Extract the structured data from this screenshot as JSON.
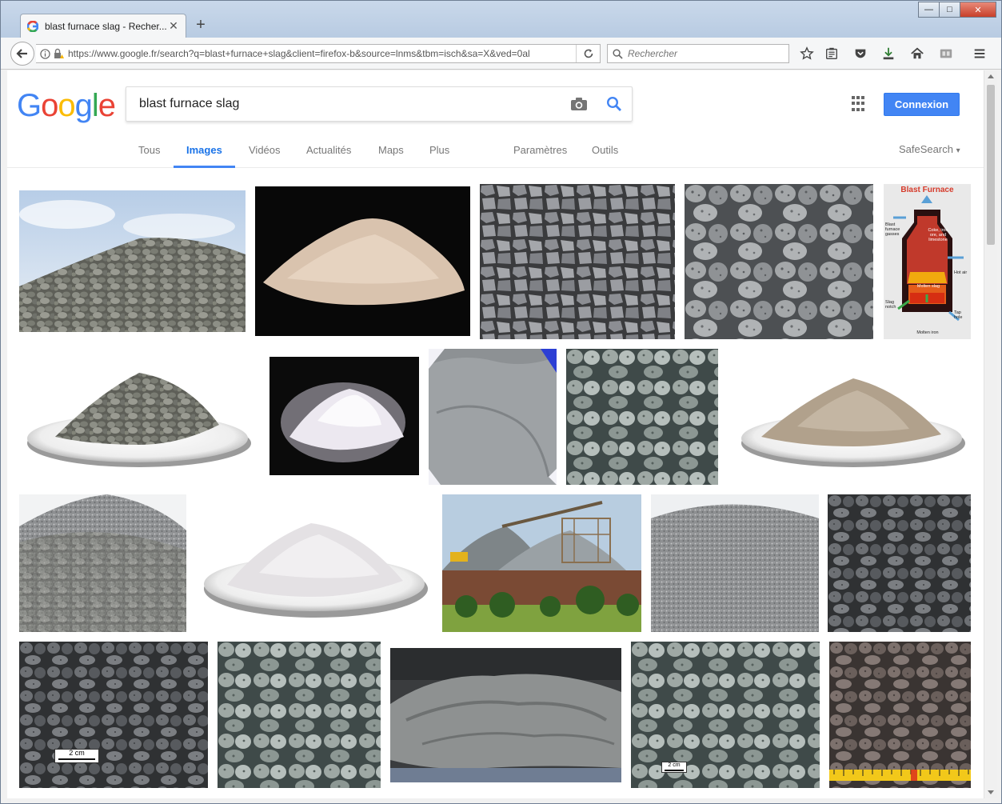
{
  "browser": {
    "tab_title": "blast furnace slag - Recher...",
    "new_tab_label": "+",
    "url": "https://www.google.fr/search?q=blast+furnace+slag&client=firefox-b&source=lnms&tbm=isch&sa=X&ved=0al",
    "url_domain": "google.fr",
    "search_placeholder": "Rechercher",
    "controls": {
      "minimize": "—",
      "maximize": "□",
      "close": "✕"
    }
  },
  "google": {
    "logo": [
      "G",
      "o",
      "o",
      "g",
      "l",
      "e"
    ],
    "logo_colors": [
      "#4285f4",
      "#ea4335",
      "#fbbc05",
      "#4285f4",
      "#34a853",
      "#ea4335"
    ],
    "query": "blast furnace slag",
    "signin_label": "Connexion",
    "tabs": {
      "all": "Tous",
      "images": "Images",
      "videos": "Vidéos",
      "news": "Actualités",
      "maps": "Maps",
      "more": "Plus",
      "settings": "Paramètres",
      "tools": "Outils"
    },
    "safesearch": "SafeSearch",
    "safesearch_caret": "▾"
  },
  "infographic": {
    "title": "Blast Furnace",
    "labels": {
      "charge": "Coke, iron ore, and limestone",
      "gasses": "Blast furnace gasses",
      "hot_air": "Hot air",
      "molten_slag": "Molten slag",
      "slag_notch": "Slag notch",
      "tap_hole": "Tap hole",
      "molten_iron": "Molten iron"
    }
  },
  "scale_labels": [
    "2 cm",
    "2 cm"
  ],
  "accent": "#4285f4"
}
